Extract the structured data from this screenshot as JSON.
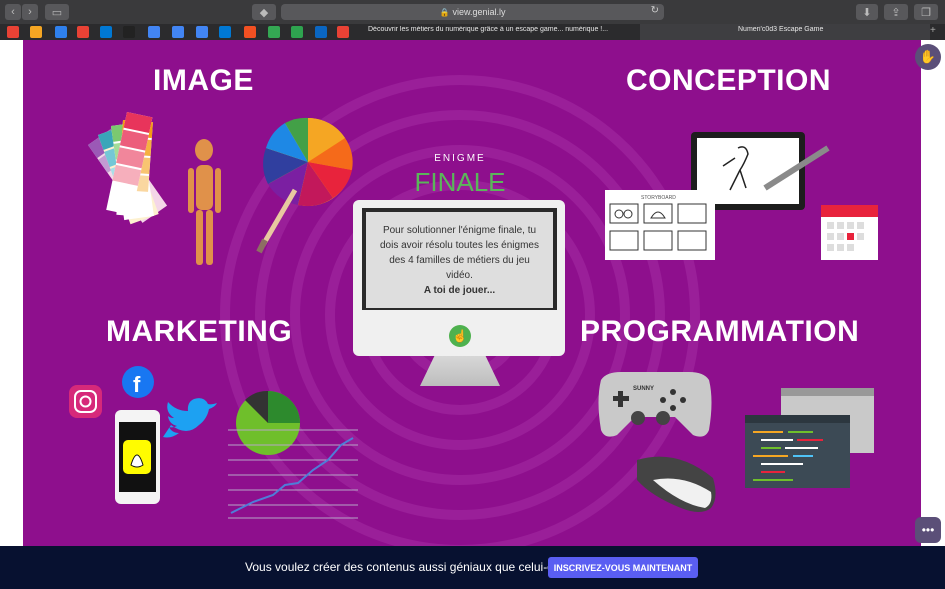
{
  "browser": {
    "url": "view.genial.ly",
    "tab_1_title": "Découvrir les métiers du numérique grâce à un escape game... numérique !...",
    "tab_2_title": "Numeri'c0d3 Escape Game",
    "bookmark_colors": [
      "#e94235",
      "#f5a623",
      "#2f80ed",
      "#e94235",
      "#0078d4",
      "#222",
      "#4285f4",
      "#4285f4",
      "#4285f4",
      "#0078d4",
      "#f25022",
      "#34a853",
      "#2ea44f",
      "#0a66c2",
      "#e94235"
    ]
  },
  "scene": {
    "background": "#8e0f8d",
    "image_title": "IMAGE",
    "conception_title": "CONCEPTION",
    "marketing_title": "MARKETING",
    "programmation_title": "PROGRAMMATION",
    "enigme_label": "ENIGME",
    "finale_label": "FINALE",
    "screen_text": "Pour solutionner l'énigme finale, tu dois avoir résolu toutes les énigmes des 4 familles de métiers du jeu vidéo.",
    "screen_cta": "A toi de jouer...",
    "storyboard_label": "STORYBOARD",
    "gamepad_label": "SUNNY"
  },
  "banner": {
    "text": "Vous voulez créer des contenus aussi géniaux que celui-ci ?",
    "button_label": "INSCRIVEZ-VOUS MAINTENANT"
  }
}
